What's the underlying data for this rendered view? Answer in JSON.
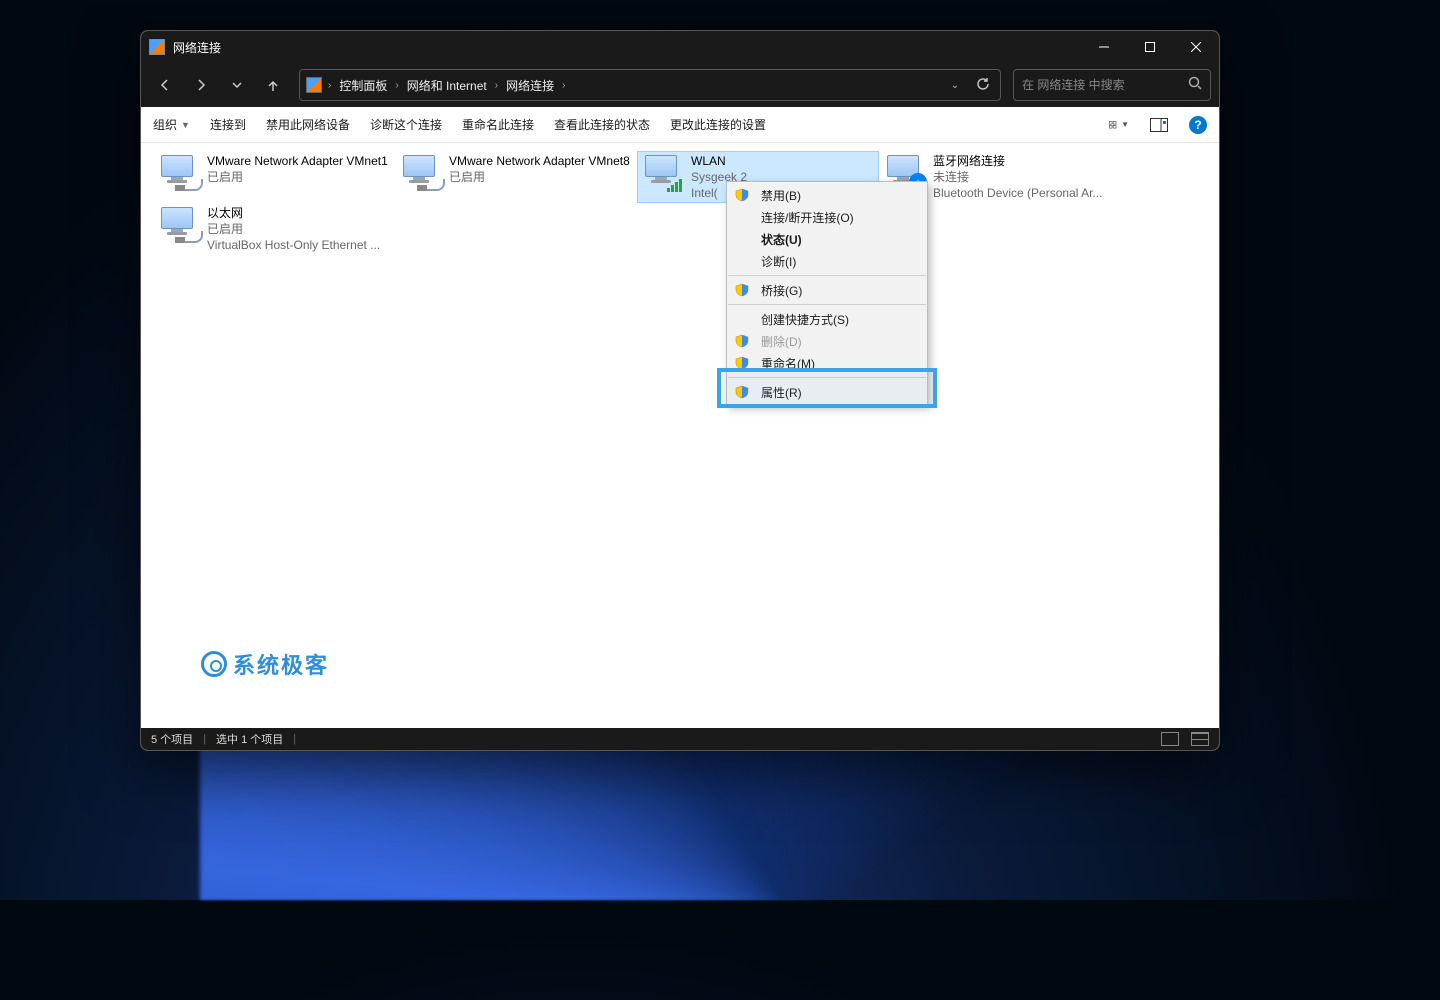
{
  "window": {
    "title": "网络连接"
  },
  "breadcrumb": {
    "items": [
      "控制面板",
      "网络和 Internet",
      "网络连接"
    ]
  },
  "search": {
    "placeholder": "在 网络连接 中搜索"
  },
  "commands": {
    "organize": "组织",
    "connect_to": "连接到",
    "disable": "禁用此网络设备",
    "diagnose": "诊断这个连接",
    "rename": "重命名此连接",
    "status": "查看此连接的状态",
    "change_settings": "更改此连接的设置"
  },
  "items": [
    {
      "name": "VMware Network Adapter VMnet1",
      "line2": "已启用",
      "line3": "",
      "kind": "eth"
    },
    {
      "name": "VMware Network Adapter VMnet8",
      "line2": "已启用",
      "line3": "",
      "kind": "eth"
    },
    {
      "name": "WLAN",
      "line2": "Sysgeek 2",
      "line3": "Intel(",
      "kind": "wifi",
      "selected": true
    },
    {
      "name": "蓝牙网络连接",
      "line2": "未连接",
      "line3": "Bluetooth Device (Personal Ar...",
      "kind": "bt"
    },
    {
      "name": "以太网",
      "line2": "已启用",
      "line3": "VirtualBox Host-Only Ethernet ...",
      "kind": "eth"
    }
  ],
  "context_menu": {
    "disable": "禁用(B)",
    "connect": "连接/断开连接(O)",
    "status": "状态(U)",
    "diagnose": "诊断(I)",
    "bridge": "桥接(G)",
    "shortcut": "创建快捷方式(S)",
    "delete": "删除(D)",
    "rename": "重命名(M)",
    "properties": "属性(R)"
  },
  "statusbar": {
    "count": "5 个项目",
    "selected": "选中 1 个项目"
  },
  "watermark": "系统极客"
}
